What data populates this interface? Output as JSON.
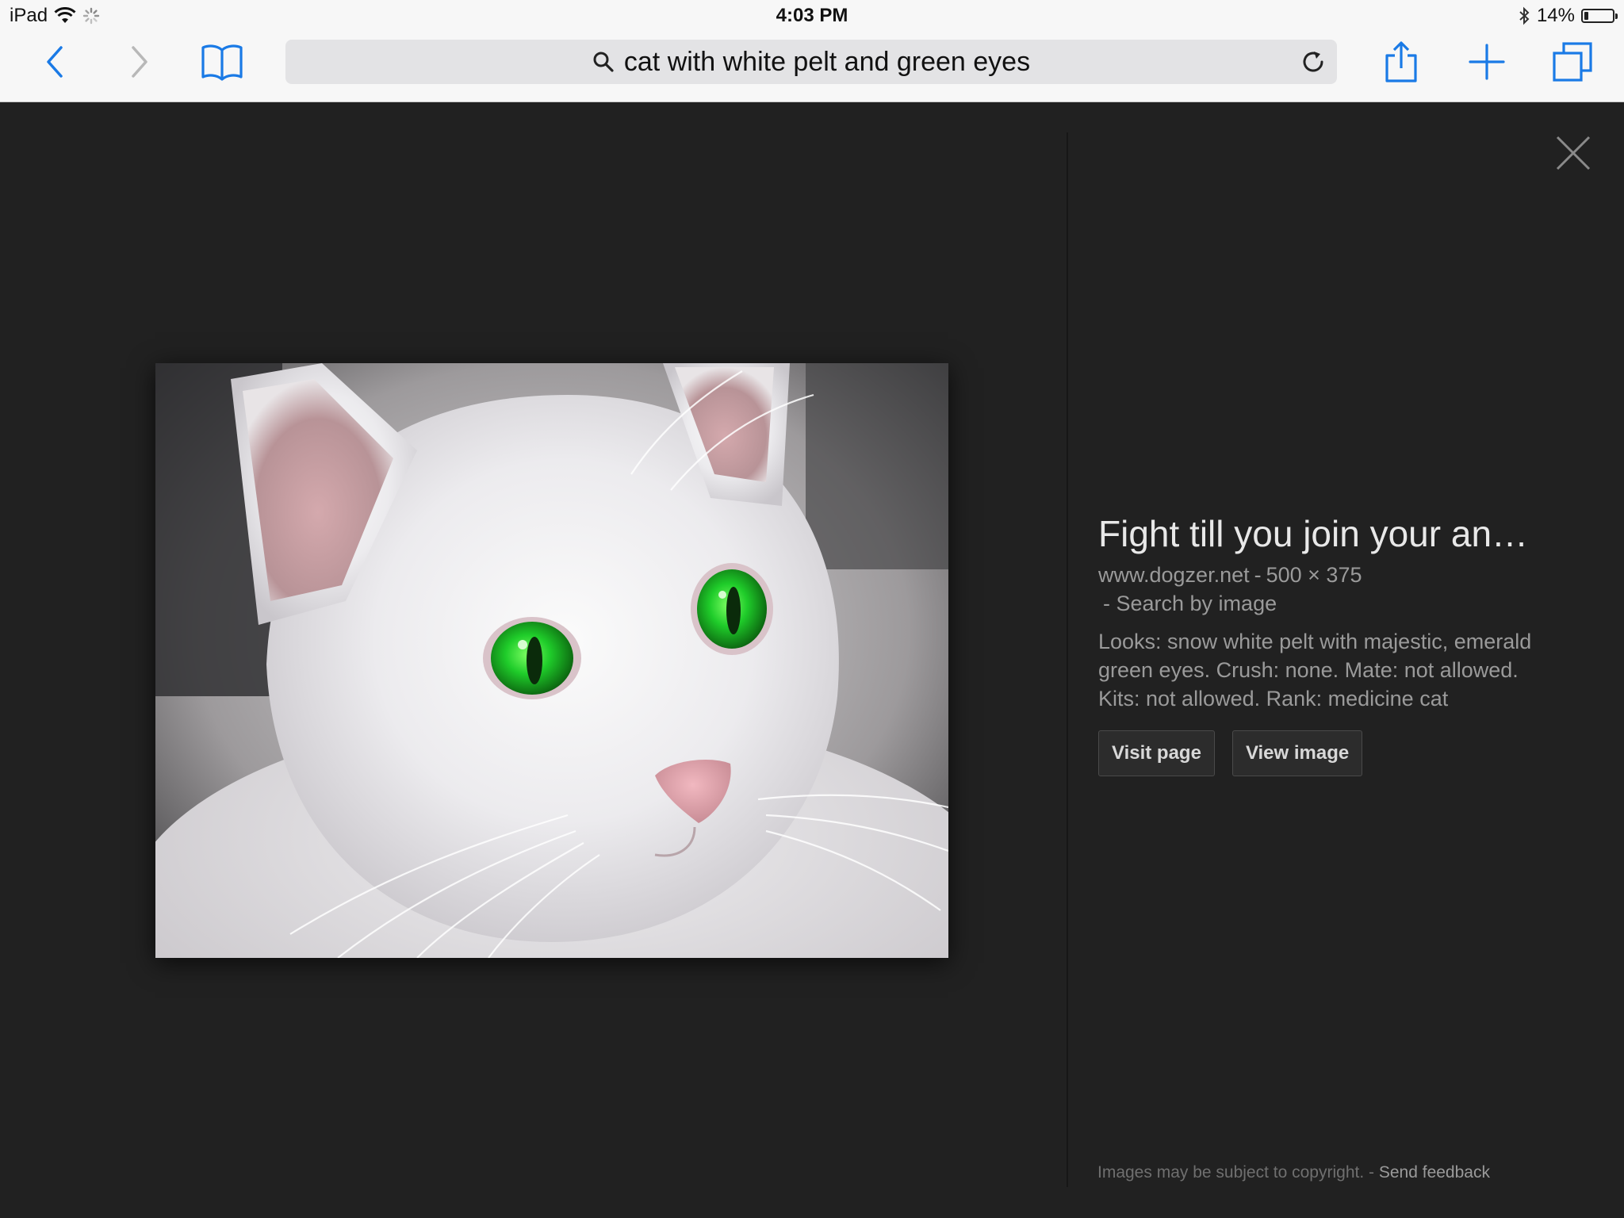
{
  "status_bar": {
    "device": "iPad",
    "time": "4:03 PM",
    "battery_text": "14%",
    "battery_level": 0.14
  },
  "toolbar": {
    "search_query": "cat with white pelt and green eyes"
  },
  "result": {
    "title": "Fight till you join your an…",
    "domain": "www.dogzer.net",
    "separator": "-",
    "dimensions": "500 × 375",
    "search_by_image": "- Search by image",
    "description": "Looks: snow white pelt with majestic, emerald green eyes. Crush: none. Mate: not allowed. Kits: not allowed. Rank: medicine cat",
    "visit_page_label": "Visit page",
    "view_image_label": "View image"
  },
  "footer": {
    "copyright": "Images may be subject to copyright.",
    "separator": "-",
    "feedback": "Send feedback"
  },
  "colors": {
    "ios_blue": "#1a7ae6",
    "viewer_bg": "#212121",
    "eye_green": "#1fcc2a"
  },
  "icons": [
    "back-icon",
    "forward-icon",
    "bookmarks-icon",
    "search-icon",
    "reload-icon",
    "share-icon",
    "new-tab-icon",
    "tabs-icon",
    "close-icon",
    "wifi-icon",
    "activity-icon",
    "bluetooth-icon",
    "battery-icon"
  ]
}
